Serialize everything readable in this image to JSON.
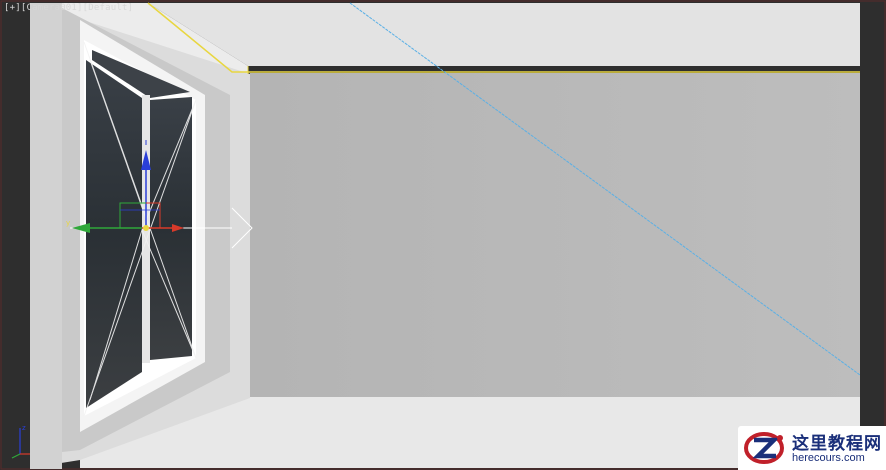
{
  "viewport": {
    "label": {
      "plus": "[+]",
      "camera": "[Camera001]",
      "shading": "[Default]"
    }
  },
  "watermark": {
    "title": "这里教程网",
    "url": "herecours.com"
  },
  "colors": {
    "selection_outline": "#e8d640",
    "frame_line": "#5ab0e6",
    "axis_x": "#d83a2a",
    "axis_y": "#2fa83a",
    "axis_z": "#2a3fd8",
    "wall_back": "#b8b8b8",
    "wall_left": "#dedede",
    "ceiling": "#e3e3e3",
    "floor": "#e8e8e8",
    "window_glass": "#2b3137",
    "brand": "#1a2f7a"
  },
  "icons": [
    "transform-gizmo-icon",
    "axis-tripod-icon",
    "watermark-logo-icon"
  ]
}
